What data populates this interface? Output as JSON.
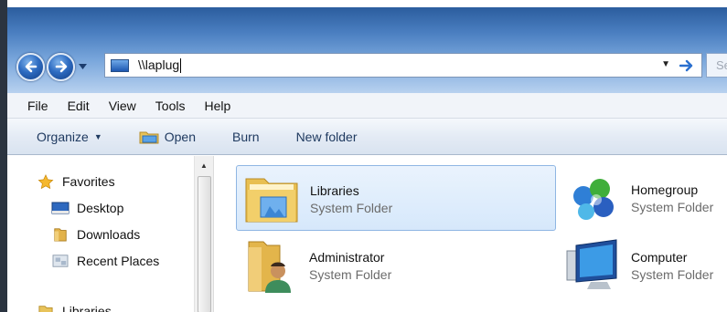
{
  "address": {
    "path": "\\\\laplug",
    "search_placeholder": "Se"
  },
  "menu": [
    "File",
    "Edit",
    "View",
    "Tools",
    "Help"
  ],
  "commands": {
    "organize": "Organize",
    "open": "Open",
    "burn": "Burn",
    "new_folder": "New folder"
  },
  "nav_pane": {
    "favorites": "Favorites",
    "items": [
      "Desktop",
      "Downloads",
      "Recent Places"
    ],
    "libraries": "Libraries"
  },
  "content": {
    "items": [
      {
        "name": "Libraries",
        "type": "System Folder"
      },
      {
        "name": "Homegroup",
        "type": "System Folder"
      },
      {
        "name": "Administrator",
        "type": "System Folder"
      },
      {
        "name": "Computer",
        "type": "System Folder"
      }
    ]
  },
  "colors": {
    "accent": "#2e6cc2",
    "selection": "#d6e8fb"
  }
}
